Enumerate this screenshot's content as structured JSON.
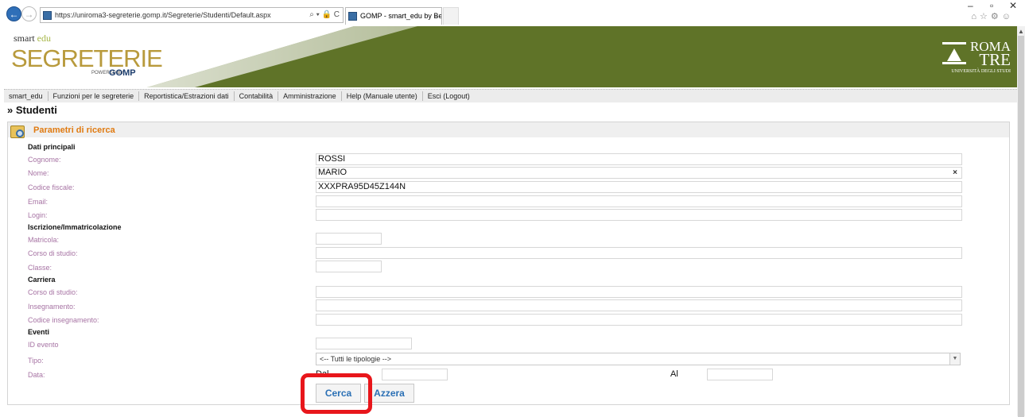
{
  "browser": {
    "url": "https://uniroma3-segreterie.gomp.it/Segreterie/Studenti/Default.aspx",
    "url_controls": "⌕ ▾ 🔒 C",
    "tab_title": "GOMP - smart_edu by Be S...",
    "tab_close": "×"
  },
  "window_controls": {
    "minimize": "–",
    "maximize": "▫",
    "close": "✕"
  },
  "toolbar_icons": "⌂☆⚙☺",
  "banner": {
    "smart": "smart",
    "edu": "edu",
    "segreterie": "SEGRETERIE",
    "powered": "POWERED BY",
    "gomp": "GOMP",
    "roma_line1": "ROMA",
    "roma_line2": "TRE",
    "roma_line3": "UNIVERSITÀ DEGLI STUDI"
  },
  "menu": [
    "smart_edu",
    "Funzioni per le segreterie",
    "Reportistica/Estrazioni dati",
    "Contabilità",
    "Amministrazione",
    "Help (Manuale utente)",
    "Esci (Logout)"
  ],
  "page_title": "» Studenti",
  "panel_title": "Parametri di ricerca",
  "sections": {
    "dati_principali": "Dati principali",
    "iscrizione": "Iscrizione/Immatricolazione",
    "carriera": "Carriera",
    "eventi": "Eventi"
  },
  "labels": {
    "cognome": "Cognome:",
    "nome": "Nome:",
    "codice_fiscale": "Codice fiscale:",
    "email": "Email:",
    "login": "Login:",
    "matricola": "Matricola:",
    "corso_studio_1": "Corso di studio:",
    "classe": "Classe:",
    "corso_studio_2": "Corso di studio:",
    "insegnamento": "Insegnamento:",
    "codice_insegnamento": "Codice insegnamento:",
    "id_evento": "ID evento",
    "tipo": "Tipo:",
    "data": "Data:"
  },
  "values": {
    "cognome": "ROSSI",
    "nome": "MARIO",
    "nome_clear": "×",
    "codice_fiscale": "XXXPRA95D45Z144N",
    "tipo_selected": "<-- Tutti le tipologie -->",
    "dal": "Dal",
    "al": "Al"
  },
  "buttons": {
    "cerca": "Cerca",
    "azzera": "Azzera"
  },
  "highlight_color": "#e8161b",
  "accent_color": "#e07a10",
  "banner_color": "#5f7328"
}
